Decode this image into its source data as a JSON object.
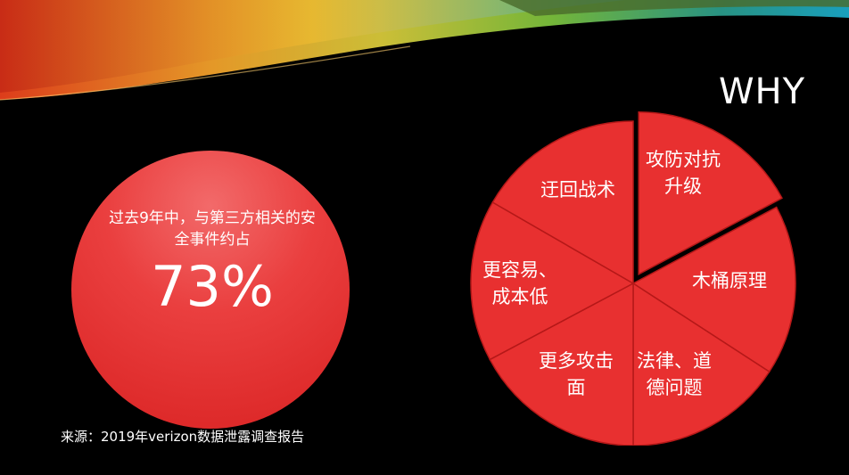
{
  "slide": {
    "title": "WHY",
    "stat": {
      "description": "过去9年中，与第三方相关的安全事件约占",
      "value": "73%"
    },
    "source": "来源：2019年verizon数据泄露调查报告"
  },
  "pie": {
    "colors": {
      "fill": "#e83030",
      "edge": "#b51818"
    },
    "segments": [
      {
        "line1": "攻防对抗",
        "line2": "升级"
      },
      {
        "line1": "木桶原理",
        "line2": ""
      },
      {
        "line1": "法律、道",
        "line2": "德问题"
      },
      {
        "line1": "更多攻击",
        "line2": "面"
      },
      {
        "line1": "更容易、",
        "line2": "成本低"
      },
      {
        "line1": "迂回战术",
        "line2": ""
      }
    ]
  }
}
